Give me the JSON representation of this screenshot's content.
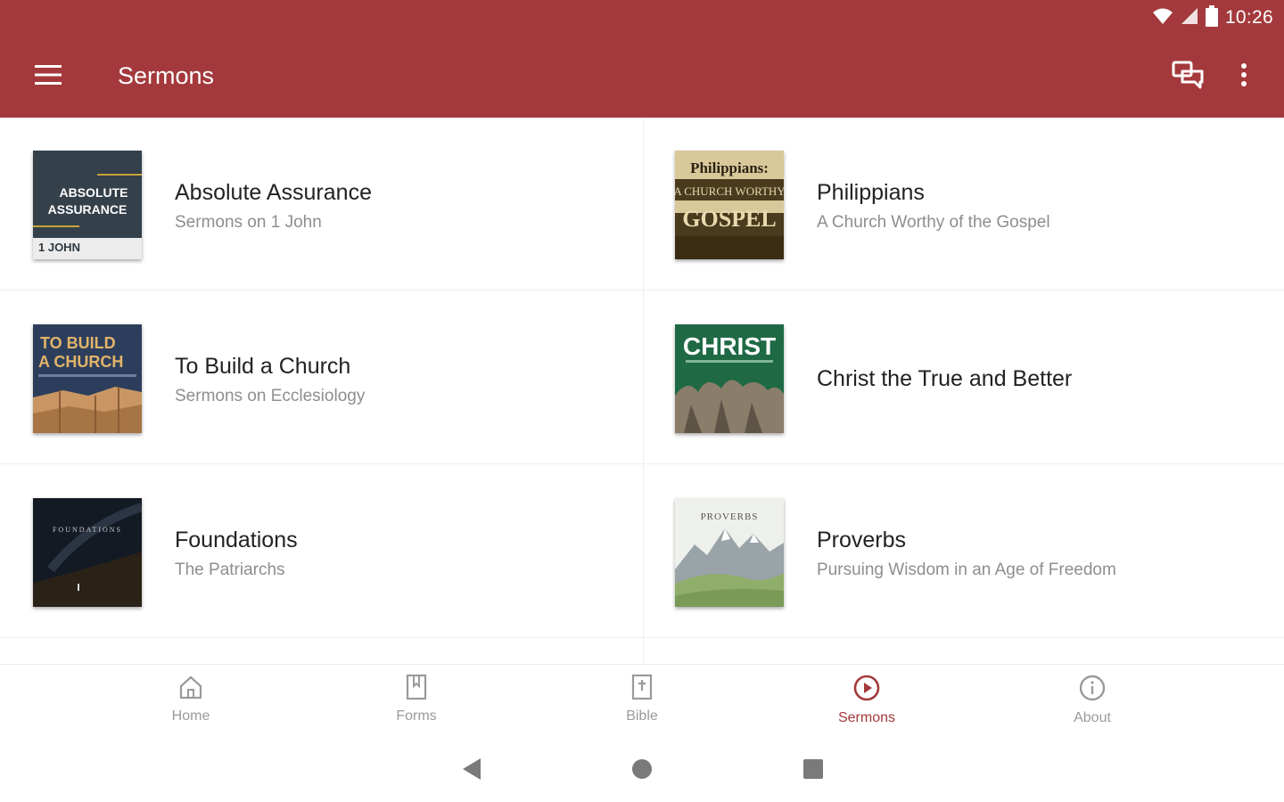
{
  "status": {
    "time": "10:26"
  },
  "appbar": {
    "title": "Sermons"
  },
  "series": [
    {
      "title": "Absolute Assurance",
      "subtitle": "Sermons on 1 John",
      "cover_text": [
        "ABSOLUTE",
        "ASSURANCE",
        "1 JOHN"
      ]
    },
    {
      "title": "Philippians",
      "subtitle": "A Church Worthy of the Gospel",
      "cover_text": [
        "Philippians:",
        "A CHURCH WORTHY",
        "GOSPEL"
      ]
    },
    {
      "title": "To Build a Church",
      "subtitle": "Sermons on Ecclesiology",
      "cover_text": [
        "TO BUILD",
        "A CHURCH"
      ]
    },
    {
      "title": "Christ the True and Better",
      "subtitle": "",
      "cover_text": [
        "CHRIST"
      ]
    },
    {
      "title": "Foundations",
      "subtitle": "The Patriarchs",
      "cover_text": [
        "FOUNDATIONS"
      ]
    },
    {
      "title": "Proverbs",
      "subtitle": "Pursuing Wisdom in an Age of Freedom",
      "cover_text": [
        "PROVERBS"
      ]
    }
  ],
  "bottom_nav": [
    {
      "label": "Home",
      "icon": "home-icon",
      "active": false
    },
    {
      "label": "Forms",
      "icon": "book-icon",
      "active": false
    },
    {
      "label": "Bible",
      "icon": "bible-icon",
      "active": false
    },
    {
      "label": "Sermons",
      "icon": "play-circle-icon",
      "active": true
    },
    {
      "label": "About",
      "icon": "info-icon",
      "active": false
    }
  ],
  "colors": {
    "primary": "#a3393c",
    "nav_inactive": "#9a9a9a",
    "subtitle": "#8e8e8e"
  }
}
